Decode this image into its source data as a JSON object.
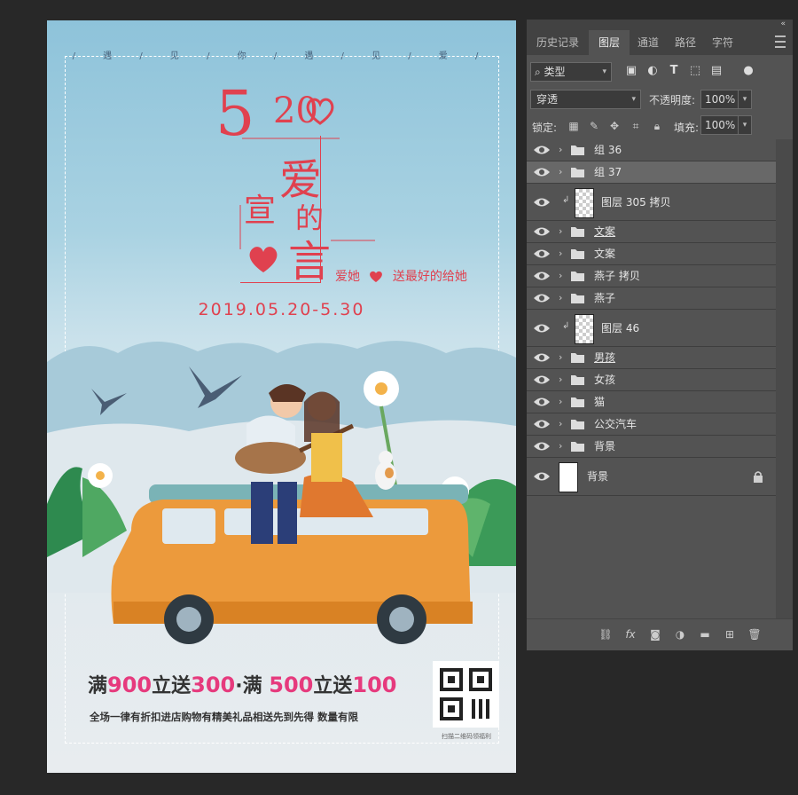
{
  "poster": {
    "tagline": "/ 遇 / 见 / 你 / 遇 / 见 / 爱 /",
    "logo_5": "5",
    "logo_20": "20",
    "title_chars": {
      "ai": "爱",
      "xuan": "宣",
      "de": "的",
      "yan": "言"
    },
    "love_left": "爱她",
    "love_right": "送最好的给她",
    "date": "2019.05.20-5.30",
    "promo": {
      "p1": "满",
      "v1": "900",
      "p2": "立送",
      "v2": "300",
      "p3": "·满 ",
      "v3": "500",
      "p4": "立送",
      "v4": "100"
    },
    "fine_print": "全场一律有折扣进店购物有精美礼品相送先到先得  数量有限",
    "qr_caption": "扫描二维码领福利",
    "colors": {
      "accent": "#e0414f",
      "promo": "#e63a7d"
    }
  },
  "panel": {
    "collapse_icon": "«",
    "tabs": [
      "历史记录",
      "图层",
      "通道",
      "路径",
      "字符"
    ],
    "active_tab": "图层",
    "filter": {
      "icon": "search-icon",
      "label": "类型"
    },
    "blend_mode": "穿透",
    "opacity_label": "不透明度:",
    "opacity_value": "100%",
    "lock_label": "锁定:",
    "fill_label": "填充:",
    "fill_value": "100%",
    "layers": [
      {
        "name": "组 36",
        "type": "group",
        "underline": false,
        "selected": false
      },
      {
        "name": "组 37",
        "type": "group",
        "underline": false,
        "selected": true
      },
      {
        "name": "图层 305 拷贝",
        "type": "layer",
        "clipped": true
      },
      {
        "name": "文案",
        "type": "group",
        "underline": true
      },
      {
        "name": "文案",
        "type": "group",
        "underline": false
      },
      {
        "name": "燕子 拷贝",
        "type": "group",
        "underline": false
      },
      {
        "name": "燕子",
        "type": "group",
        "underline": false
      },
      {
        "name": "图层 46",
        "type": "layer",
        "clipped": true
      },
      {
        "name": "男孩",
        "type": "group",
        "underline": true
      },
      {
        "name": "女孩",
        "type": "group",
        "underline": false
      },
      {
        "name": "猫",
        "type": "group",
        "underline": false
      },
      {
        "name": "公交汽车",
        "type": "group",
        "underline": false
      },
      {
        "name": "背景",
        "type": "group",
        "underline": false
      },
      {
        "name": "背景",
        "type": "background",
        "locked": true
      }
    ],
    "footer_icons": [
      "link-icon",
      "fx-icon",
      "mask-icon",
      "adjustment-icon",
      "folder-icon",
      "new-layer-icon",
      "trash-icon"
    ]
  }
}
